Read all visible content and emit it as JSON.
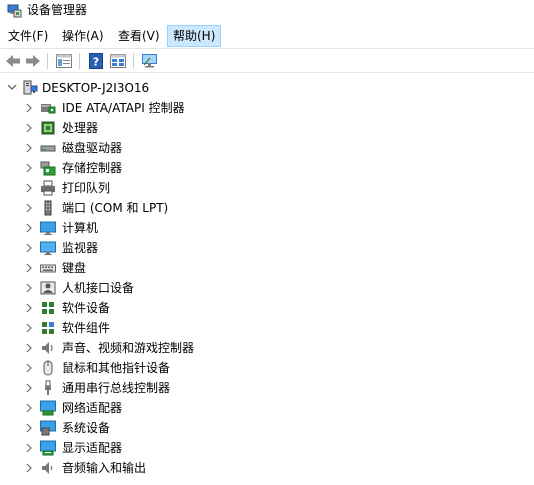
{
  "window": {
    "title": "设备管理器"
  },
  "menu": [
    "文件(F)",
    "操作(A)",
    "查看(V)",
    "帮助(H)"
  ],
  "toolbar": {
    "buttons": [
      "back-arrow-icon",
      "forward-arrow-icon",
      "properties-icon",
      "help-icon",
      "view-list-icon",
      "scan-monitor-icon"
    ]
  },
  "tree": {
    "root": "DESKTOP-J2I3O16",
    "children": [
      "IDE ATA/ATAPI 控制器",
      "处理器",
      "磁盘驱动器",
      "存储控制器",
      "打印队列",
      "端口 (COM 和 LPT)",
      "计算机",
      "监视器",
      "键盘",
      "人机接口设备",
      "软件设备",
      "软件组件",
      "声音、视频和游戏控制器",
      "鼠标和其他指针设备",
      "通用串行总线控制器",
      "网络适配器",
      "系统设备",
      "显示适配器",
      "音频输入和输出"
    ],
    "icons": [
      "ide-controller-icon",
      "processor-icon",
      "disk-drive-icon",
      "storage-controller-icon",
      "print-queue-icon",
      "port-icon",
      "computer-icon",
      "monitor-icon",
      "keyboard-icon",
      "hid-icon",
      "software-device-icon",
      "software-component-icon",
      "sound-icon",
      "mouse-icon",
      "usb-icon",
      "network-adapter-icon",
      "system-device-icon",
      "display-adapter-icon",
      "audio-io-icon"
    ]
  },
  "colors": {
    "menu_active_bg": "#cce8ff",
    "menu_active_border": "#99d1ff",
    "chevron": "#6d6d6d"
  }
}
